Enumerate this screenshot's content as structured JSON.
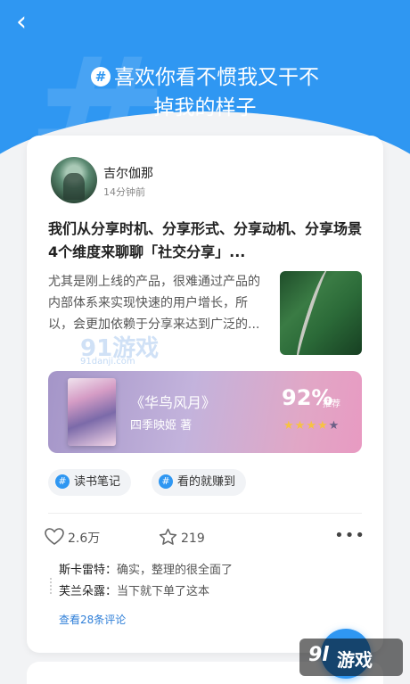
{
  "header": {
    "back_icon": "chevron-left-icon",
    "topic_hash": "#",
    "topic_line1": "喜欢你看不惯我又干不",
    "topic_line2": "掉我的样子",
    "accent_color": "#2f97f2"
  },
  "post": {
    "author": "吉尔伽那",
    "time": "14分钟前",
    "title": "我们从分享时机、分享形式、分享动机、分享场景4个维度来聊聊「社交分享」...",
    "body": "尤其是刚上线的产品，很难通过产品的内部体系来实现快速的用户增长，所以，会更加依赖于分享来达到广泛的...",
    "watermark": "91游戏",
    "watermark_sub": "91danji.com"
  },
  "book": {
    "title": "《华鸟风月》",
    "author": "四季映姬 著",
    "percent": "92%",
    "percent_label": "推荐",
    "rating": 4,
    "rating_max": 5
  },
  "tags": [
    {
      "label": "读书笔记"
    },
    {
      "label": "看的就赚到"
    }
  ],
  "actions": {
    "likes": "2.6万",
    "stars": "219",
    "more_icon": "more-dots-icon"
  },
  "comments": [
    {
      "user": "斯卡雷特：",
      "text": "确实，整理的很全面了"
    },
    {
      "user": "芙兰朵露：",
      "text": "当下就下单了这本"
    }
  ],
  "view_all": "查看28条评论",
  "site_logo": {
    "num": "9l",
    "name": "游戏"
  }
}
